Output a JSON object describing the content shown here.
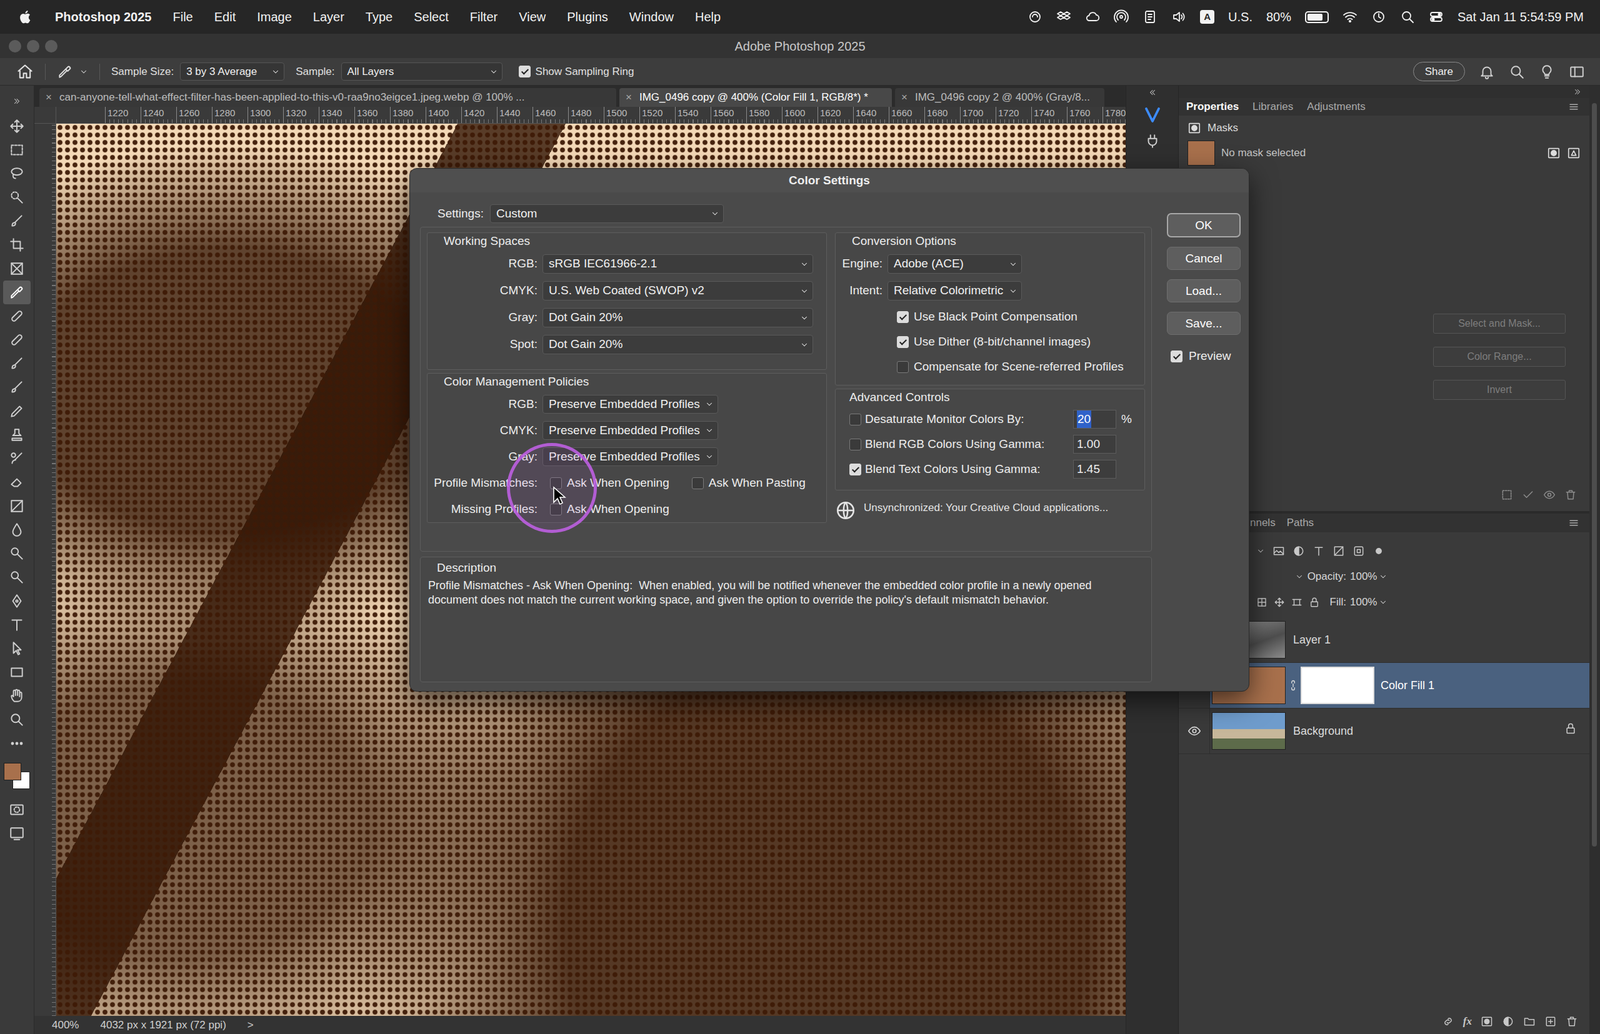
{
  "menu_bar": {
    "items": [
      {
        "label": "Photoshop 2025",
        "kind": "app"
      },
      {
        "label": "File",
        "kind": "menu"
      },
      {
        "label": "Edit",
        "kind": "menu"
      },
      {
        "label": "Image",
        "kind": "menu"
      },
      {
        "label": "Layer",
        "kind": "menu"
      },
      {
        "label": "Type",
        "kind": "menu"
      },
      {
        "label": "Select",
        "kind": "menu"
      },
      {
        "label": "Filter",
        "kind": "menu"
      },
      {
        "label": "View",
        "kind": "menu"
      },
      {
        "label": "Plugins",
        "kind": "menu"
      },
      {
        "label": "Window",
        "kind": "menu"
      },
      {
        "label": "Help",
        "kind": "menu"
      }
    ],
    "input_badge": "A",
    "input_source": "U.S.",
    "battery": "80%",
    "battery_level": 0.8,
    "clock": "Sat Jan 11 5:54:59 PM"
  },
  "window": {
    "title": "Adobe Photoshop 2025"
  },
  "options_bar": {
    "sample_size_label": "Sample Size:",
    "sample_size": "3 by 3 Average",
    "sample_label": "Sample:",
    "sample": "All Layers",
    "sampling_ring": {
      "label": "Show Sampling Ring",
      "checked": true
    },
    "share": "Share"
  },
  "doc_tabs": [
    {
      "label": "can-anyone-tell-what-effect-filter-has-been-applied-to-this-v0-raa9no3eigce1.jpeg.webp @ 100% ...",
      "close": "×",
      "selected": false
    },
    {
      "label": "IMG_0496 copy @ 400% (Color Fill 1, RGB/8*) *",
      "close": "×",
      "selected": true
    },
    {
      "label": "IMG_0496 copy 2 @ 400% (Gray/8...",
      "close": "×",
      "selected": false
    }
  ],
  "ruler": {
    "ticks": [
      "1220",
      "1240",
      "1260",
      "1280",
      "1300",
      "1320",
      "1340",
      "1360",
      "1380",
      "1400",
      "1420",
      "1440",
      "1460",
      "1480",
      "1500",
      "1520",
      "1540",
      "1560",
      "1580",
      "1600",
      "1620",
      "1640",
      "1660",
      "1680",
      "1700",
      "1720",
      "1740",
      "1760",
      "1780"
    ]
  },
  "toolbar": {
    "tools": [
      {
        "selected": false
      },
      {
        "selected": false
      },
      {
        "selected": false
      },
      {
        "selected": false
      },
      {
        "selected": false
      },
      {
        "selected": false
      },
      {
        "selected": false
      },
      {
        "selected": true
      },
      {
        "selected": false
      },
      {
        "selected": false
      },
      {
        "selected": false
      },
      {
        "selected": false
      },
      {
        "selected": false
      },
      {
        "selected": false
      },
      {
        "selected": false
      },
      {
        "selected": false
      },
      {
        "selected": false
      },
      {
        "selected": false
      },
      {
        "selected": false
      },
      {
        "selected": false
      },
      {
        "selected": false
      },
      {
        "selected": false
      },
      {
        "selected": false
      },
      {
        "selected": false
      },
      {
        "selected": false
      },
      {
        "selected": false
      }
    ],
    "foreground": "#a8704c",
    "background": "#ffffff"
  },
  "status_bar": {
    "zoom": "400%",
    "size": "4032 px x 1921 px (72 ppi)",
    "more": ">"
  },
  "properties": {
    "tabs": [
      {
        "label": "Properties",
        "selected": true
      },
      {
        "label": "Libraries",
        "selected": false
      },
      {
        "label": "Adjustments",
        "selected": false
      }
    ],
    "section": "Masks",
    "mask_status": "No mask selected",
    "buttons": [
      {
        "label": "Select and Mask...",
        "disabled": true
      },
      {
        "label": "Color Range...",
        "disabled": true
      },
      {
        "label": "Invert",
        "disabled": true
      }
    ]
  },
  "layers_panel": {
    "tabs": [
      {
        "label": "nnels",
        "selected": false
      },
      {
        "label": "Paths",
        "selected": false
      }
    ],
    "opacity_label": "Opacity:",
    "opacity": "100%",
    "fill_label": "Fill:",
    "fill": "100%",
    "fx": "fx",
    "layers": [
      {
        "name": "Layer 1",
        "kind": "photo",
        "visible": true,
        "selected": false,
        "locked": false
      },
      {
        "name": "Color Fill 1",
        "kind": "fill",
        "color": "#a8704c",
        "visible": true,
        "selected": true,
        "locked": false
      },
      {
        "name": "Background",
        "kind": "photo",
        "visible": true,
        "selected": false,
        "locked": true
      }
    ]
  },
  "dialog": {
    "title": "Color Settings",
    "settings_label": "Settings:",
    "settings": "Custom",
    "working_spaces": {
      "title": "Working Spaces",
      "rows": [
        {
          "label": "RGB:",
          "value": "sRGB IEC61966-2.1"
        },
        {
          "label": "CMYK:",
          "value": "U.S. Web Coated (SWOP) v2"
        },
        {
          "label": "Gray:",
          "value": "Dot Gain 20%"
        },
        {
          "label": "Spot:",
          "value": "Dot Gain 20%"
        }
      ]
    },
    "policies": {
      "title": "Color Management Policies",
      "rows": [
        {
          "label": "RGB:",
          "value": "Preserve Embedded Profiles"
        },
        {
          "label": "CMYK:",
          "value": "Preserve Embedded Profiles"
        },
        {
          "label": "Gray:",
          "value": "Preserve Embedded Profiles"
        }
      ],
      "mismatches": {
        "label": "Profile Mismatches:",
        "options": [
          {
            "label": "Ask When Opening",
            "checked": false
          },
          {
            "label": "Ask When Pasting",
            "checked": false
          }
        ]
      },
      "missing": {
        "label": "Missing Profiles:",
        "options": [
          {
            "label": "Ask When Opening",
            "checked": false
          }
        ]
      }
    },
    "conversion": {
      "title": "Conversion Options",
      "engine_label": "Engine:",
      "engine": "Adobe (ACE)",
      "intent_label": "Intent:",
      "intent": "Relative Colorimetric",
      "options": [
        {
          "label": "Use Black Point Compensation",
          "checked": true
        },
        {
          "label": "Use Dither (8-bit/channel images)",
          "checked": true
        },
        {
          "label": "Compensate for Scene-referred Profiles",
          "checked": false
        }
      ]
    },
    "advanced": {
      "title": "Advanced Controls",
      "rows": [
        {
          "label": "Desaturate Monitor Colors By:",
          "checked": false,
          "value": "20",
          "unit": "%",
          "text_selected": true
        },
        {
          "label": "Blend RGB Colors Using Gamma:",
          "checked": false,
          "value": "1.00",
          "text_selected": false
        },
        {
          "label": "Blend Text Colors Using Gamma:",
          "checked": true,
          "value": "1.45",
          "text_selected": false
        }
      ]
    },
    "sync": "Unsynchronized: Your Creative Cloud applications...",
    "description": {
      "title": "Description",
      "text": "Profile Mismatches - Ask When Opening:  When enabled, you will be notified whenever the embedded color profile in a newly opened document does not match the current working space, and given the option to override the policy's default mismatch behavior."
    },
    "buttons": [
      {
        "label": "OK",
        "default": true
      },
      {
        "label": "Cancel",
        "default": false
      },
      {
        "label": "Load...",
        "default": false
      },
      {
        "label": "Save...",
        "default": false
      }
    ],
    "preview": {
      "label": "Preview",
      "checked": true
    }
  }
}
